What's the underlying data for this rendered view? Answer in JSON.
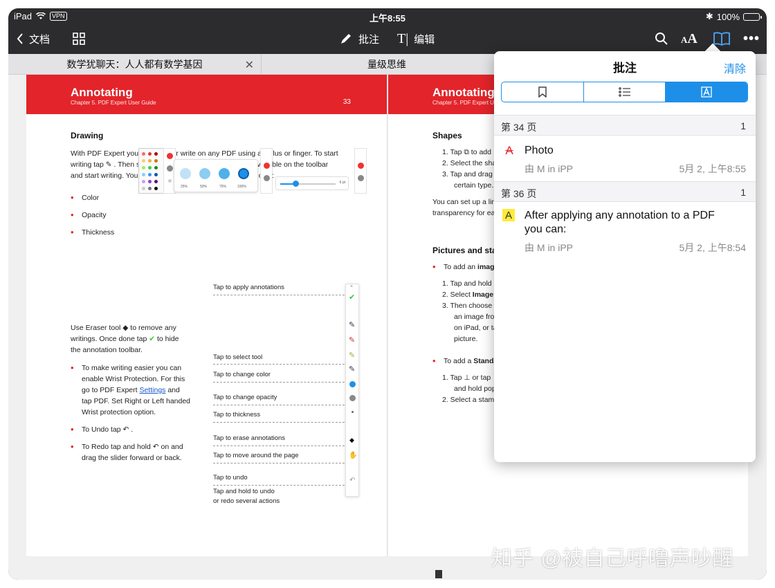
{
  "status_bar": {
    "device": "iPad",
    "vpn": "VPN",
    "time": "上午8:55",
    "battery": "100%"
  },
  "toolbar": {
    "back_label": "文档",
    "annotate_label": "批注",
    "edit_label": "编辑",
    "text_size_icon": "AA"
  },
  "tabs": [
    {
      "label": "数学犹聊天：人人都有数学基因"
    },
    {
      "label": "量级思维"
    }
  ],
  "page_left": {
    "header_title": "Annotating",
    "header_subtitle": "Chapter 5. PDF Expert User Guide",
    "page_number": "33",
    "drawing_heading": "Drawing",
    "drawing_p1": "With PDF Expert you can draw or write on any PDF using a stylus or finger. To start",
    "drawing_p2_a": "writing tap",
    "drawing_p2_b": ". Then select one of the pencils or markers available on the toolbar",
    "drawing_p3": "and start writing. You can set up 4 different pens with their own:",
    "pen_props": [
      "Color",
      "Opacity",
      "Thickness"
    ],
    "picker_labels": [
      "25%",
      "50%",
      "75%",
      "100%"
    ],
    "slider_label": "6 pt",
    "eraser_l1_a": "Use Eraser tool",
    "eraser_l1_b": "to remove any",
    "eraser_l2_a": "writings. Once done tap",
    "eraser_l2_b": "to hide",
    "eraser_l3": "the annotation toolbar.",
    "wrist_lines_a": [
      "To make writing easier you can",
      "enable Wrist Protection. For this"
    ],
    "wrist_l3_a": "go to PDF Expert",
    "wrist_link": "Settings",
    "wrist_l3_b": "and",
    "wrist_lines_b": [
      "tap PDF. Set Right or Left handed",
      "Wrist protection option."
    ],
    "undo_line": "To Undo tap",
    "redo_l1_a": "To Redo tap and hold",
    "redo_l1_b": "on and",
    "redo_l2": "drag the slider forward or back.",
    "callouts": [
      "Tap to apply annotations",
      "Tap to select tool",
      "Tap to change color",
      "Tap to change opacity",
      "Tap to thickness",
      "Tap to erase annotations",
      "Tap to move around the page",
      "Tap to undo",
      "Tap and hold to undo",
      "or redo several actions"
    ]
  },
  "page_right": {
    "header_title": "Annotating",
    "header_subtitle": "Chapter 5. PDF Expert User Guide",
    "shapes_heading": "Shapes",
    "shapes_1_a": "1. Tap",
    "shapes_1_b": "to add",
    "shapes_2": "2. Select the shap",
    "shapes_3": "3. Tap and drag t",
    "shapes_3b": "certain type.",
    "shapes_p1": "You can set up a line c",
    "shapes_p2": "transparency for each",
    "pictures_heading": "Pictures and stam",
    "pic_bullet_a": "To add an",
    "pic_bullet_b": "image t",
    "pic_list": [
      "1. Tap and hold c"
    ],
    "pic_2_a": "2. Select",
    "pic_2_b": "Image fr",
    "pic_3_a": "3. Then choose",
    "pic_3_b": "P",
    "pic_3_rest": [
      "an image from",
      "on iPad, or tap",
      "picture."
    ],
    "std_bullet_a": "To add a",
    "std_bullet_b": "Standard",
    "std_1_a": "1. Tap",
    "std_1_b": "or tap",
    "std_1_c": "and hold pop-u",
    "std_2": "2. Select a stamp"
  },
  "annotations_panel": {
    "title": "批注",
    "clear_label": "清除",
    "sections": [
      {
        "page_label": "第 34 页",
        "count": "1",
        "items": [
          {
            "icon": "strikethrough-icon",
            "title": "Photo",
            "author": "由 M in iPP",
            "date": "5月 2, 上午8:55"
          }
        ]
      },
      {
        "page_label": "第 36 页",
        "count": "1",
        "items": [
          {
            "icon": "highlight-icon",
            "title_l1": "After applying any annotation to a PDF",
            "title_l2": "you can:",
            "author": "由 M in iPP",
            "date": "5月 2, 上午8:54"
          }
        ]
      }
    ]
  },
  "colors": {
    "accent": "#1e8fe8",
    "header_red": "#e3242b",
    "toolbar_bg": "#2c2c2e",
    "highlight": "#ffeb3b"
  },
  "watermark": "知乎 @被自己呼噜声吵醒"
}
